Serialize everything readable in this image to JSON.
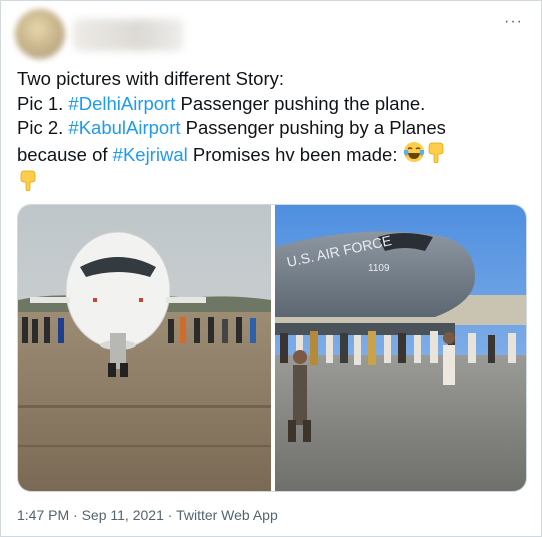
{
  "tweet": {
    "more_label": "···",
    "lines": [
      {
        "plain": "Two pictures with different Story:"
      },
      {
        "before": "Pic 1. ",
        "tag": "#DelhiAirport",
        "after": " Passenger pushing the plane."
      },
      {
        "before": "Pic 2. ",
        "tag": "#KabulAirport",
        "after": " Passenger pushing by a Planes"
      },
      {
        "before": "because of ",
        "tag": "#Kejriwal",
        "after": " Promises hv been made: "
      }
    ],
    "emojis": [
      "laughing-tears",
      "pointing-down",
      "pointing-down"
    ],
    "footer": {
      "time": "1:47 PM",
      "date": "Sep 11, 2021",
      "source": "Twitter Web App"
    }
  },
  "media": {
    "photo2_fuselage_text": "U.S. AIR FORCE",
    "photo2_tail_number": "1109"
  },
  "colors": {
    "link": "#1d9bf0",
    "text": "#0f1419",
    "muted": "#536471",
    "border": "#cfd9de"
  }
}
